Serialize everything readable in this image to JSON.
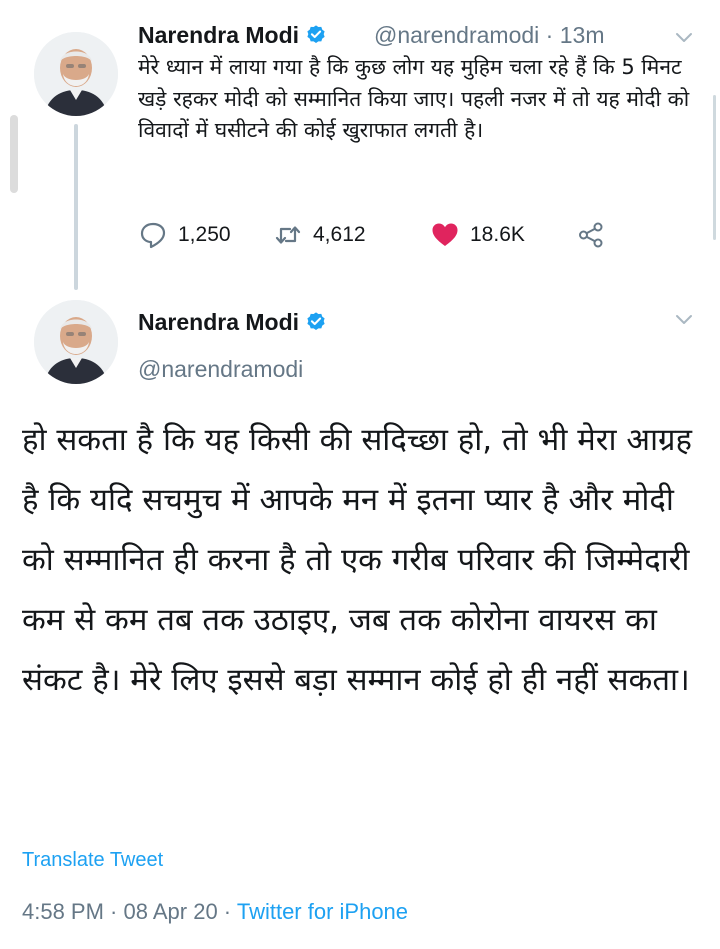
{
  "tweet1": {
    "author_name": "Narendra Modi",
    "handle": "@narendramodi",
    "time": "13m",
    "separator": " · ",
    "text": "मेरे ध्यान में लाया गया है कि कुछ लोग यह मुहिम चला रहे हैं कि 5 मिनट खड़े रहकर मोदी को सम्मानित किया जाए। पहली नजर में तो यह मोदी को विवादों में घसीटने की कोई खुराफात लगती है।",
    "replies": "1,250",
    "retweets": "4,612",
    "likes": "18.6K",
    "icons": {
      "reply": "reply-icon",
      "retweet": "retweet-icon",
      "like": "heart-icon",
      "share": "share-icon",
      "verified": "verified-badge-icon",
      "menu": "chevron-down-icon"
    }
  },
  "tweet2": {
    "author_name": "Narendra Modi",
    "handle": "@narendramodi",
    "text": "हो सकता है कि यह किसी की सदिच्छा हो, तो भी मेरा आग्रह है कि यदि सचमुच में आपके मन में इतना प्यार है और मोदी को सम्मानित ही करना है तो एक गरीब परिवार की जिम्मेदारी कम से कम तब तक उठाइए, जब तक कोरोना वायरस का संकट है। मेरे लिए इससे बड़ा सम्मान कोई हो ही नहीं सकता।",
    "translate_label": "Translate Tweet",
    "time": "4:58 PM",
    "date": "08 Apr 20",
    "separator": " · ",
    "source": "Twitter for iPhone"
  },
  "colors": {
    "accent": "#1da1f2",
    "like": "#e0245e",
    "secondary_text": "#657786",
    "primary_text": "#14171a"
  }
}
